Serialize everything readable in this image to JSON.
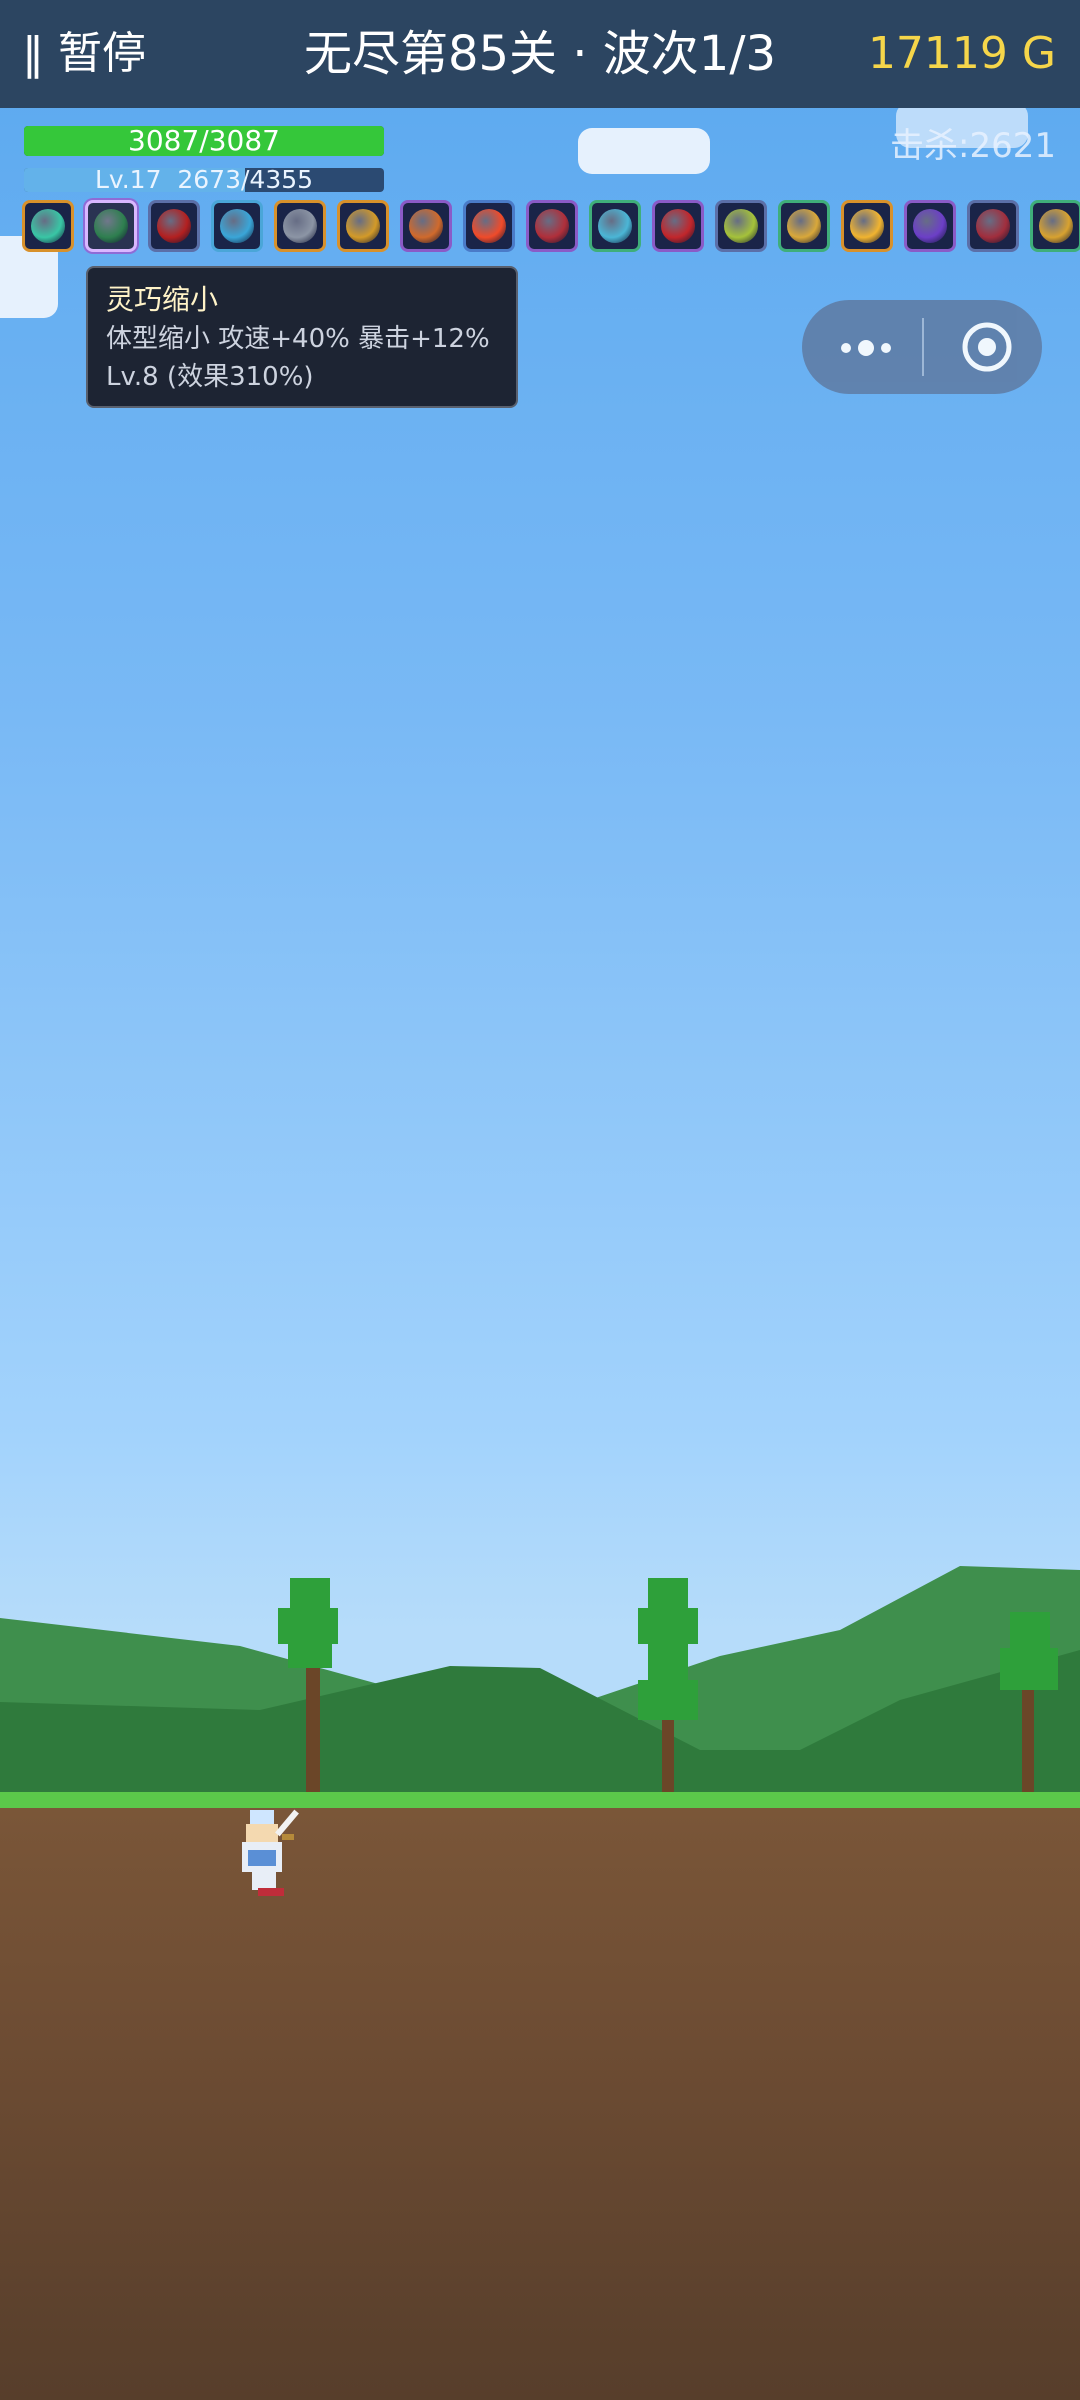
{
  "topbar": {
    "pause_label": "‖ 暂停",
    "stage_title": "无尽第85关 · 波次1/3",
    "gold": "17119 G"
  },
  "player": {
    "hp_text": "3087/3087",
    "hp_fraction": 1.0,
    "xp_text": "Lv.17  2673/4355",
    "xp_fraction": 0.614
  },
  "kills_text": "击杀:2621",
  "skills": [
    {
      "icon": "tornado-icon",
      "color": "#39c6a5"
    },
    {
      "icon": "shrink-icon",
      "color": "#2e7f4f",
      "selected": true
    },
    {
      "icon": "demon-rune-icon",
      "color": "#b32020"
    },
    {
      "icon": "blue-blade-icon",
      "color": "#3aa6d8"
    },
    {
      "icon": "knight-helmet-icon",
      "color": "#8c95a5"
    },
    {
      "icon": "golden-shield-icon",
      "color": "#d39a28"
    },
    {
      "icon": "fire-sword-icon",
      "color": "#d06a2c"
    },
    {
      "icon": "flame-orb-icon",
      "color": "#f04b2a"
    },
    {
      "icon": "crossed-axes-icon",
      "color": "#b02f3a"
    },
    {
      "icon": "ice-shards-icon",
      "color": "#4bb6d6"
    },
    {
      "icon": "red-battleaxe-icon",
      "color": "#c2262b"
    },
    {
      "icon": "poison-gem-icon",
      "color": "#a5c23a"
    },
    {
      "icon": "golden-arrow-icon",
      "color": "#d9a83a"
    },
    {
      "icon": "sun-star-icon",
      "color": "#f1b430"
    },
    {
      "icon": "void-crystal-icon",
      "color": "#6c3fc7"
    },
    {
      "icon": "rune-tablet-icon",
      "color": "#a12e3d"
    },
    {
      "icon": "gold-armor-icon",
      "color": "#d8a230"
    }
  ],
  "tooltip": {
    "title": "灵巧缩小",
    "line1": "体型缩小 攻速+40% 暴击+12%",
    "line2": "Lv.8 (效果310%)"
  },
  "capsule": {
    "more_icon": "more-dots-icon",
    "close_icon": "target-close-icon"
  },
  "colors": {
    "topbar": "#2c4561",
    "gold": "#f6d64a",
    "hp": "#35c73a",
    "xp": "#63b2ea",
    "grass": "#5bc84a",
    "ground": "#6d4c33"
  }
}
